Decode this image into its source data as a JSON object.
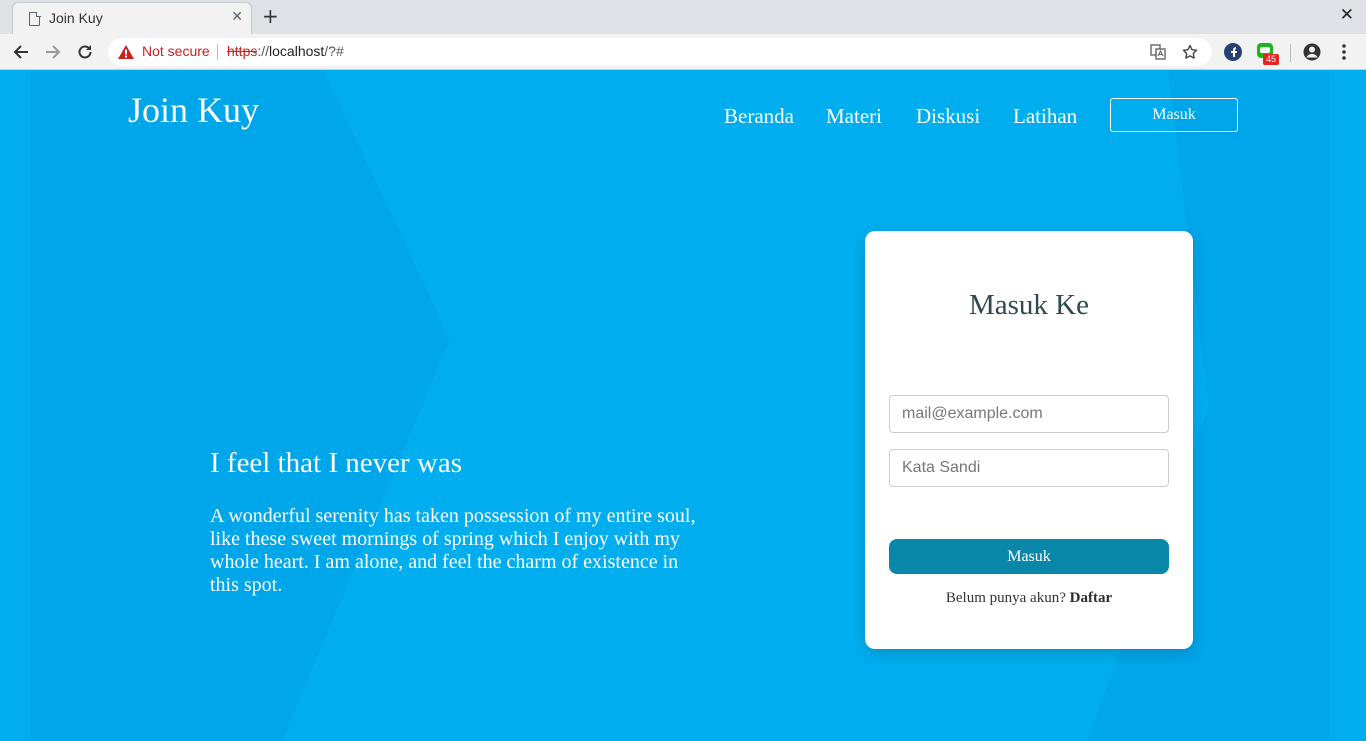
{
  "browser": {
    "tab_title": "Join Kuy",
    "security_label": "Not secure",
    "url_scheme": "https",
    "url_separator": "://",
    "url_host": "localhost",
    "url_path": "/?#",
    "extension_badge": "45"
  },
  "header": {
    "brand": "Join Kuy",
    "nav": [
      {
        "label": "Beranda"
      },
      {
        "label": "Materi"
      },
      {
        "label": "Diskusi"
      },
      {
        "label": "Latihan"
      }
    ],
    "login_button": "Masuk"
  },
  "hero": {
    "title": "I feel that I never was",
    "text": "A wonderful serenity has taken possession of my entire soul, like these sweet mornings of spring which I enjoy with my whole heart. I am alone, and feel the charm of existence in this spot."
  },
  "login_card": {
    "title": "Masuk Ke",
    "email_placeholder": "mail@example.com",
    "email_value": "",
    "password_placeholder": "Kata Sandi",
    "password_value": "",
    "submit_label": "Masuk",
    "signup_prompt": "Belum punya akun?",
    "signup_link": "Daftar"
  },
  "colors": {
    "page_background": "#00aef0",
    "submit_button": "#0887a8",
    "card_title": "#2d4a50",
    "not_secure": "#c5221f"
  }
}
